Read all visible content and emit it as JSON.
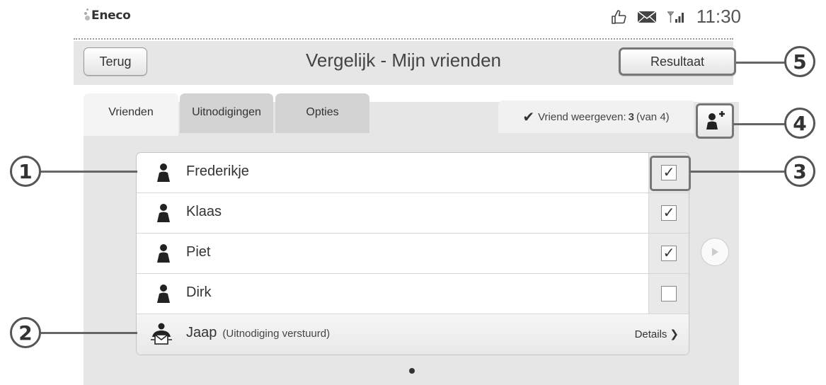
{
  "status": {
    "logo": "Eneco",
    "time": "11:30"
  },
  "header": {
    "back_label": "Terug",
    "title": "Vergelijk - Mijn vrienden",
    "result_label": "Resultaat"
  },
  "tabs": [
    {
      "label": "Vrienden",
      "active": true
    },
    {
      "label": "Uitnodigingen",
      "active": false
    },
    {
      "label": "Opties",
      "active": false
    }
  ],
  "friend_count": {
    "prefix": "Vriend weergeven:",
    "shown": "3",
    "total": "(van 4)"
  },
  "friends": [
    {
      "name": "Frederikje",
      "checked": true
    },
    {
      "name": "Klaas",
      "checked": true
    },
    {
      "name": "Piet",
      "checked": true
    },
    {
      "name": "Dirk",
      "checked": false
    }
  ],
  "invite": {
    "name": "Jaap",
    "status": "(Uitnodiging verstuurd)",
    "details_label": "Details"
  },
  "callouts": [
    "1",
    "2",
    "3",
    "4",
    "5"
  ],
  "colors": {
    "panel": "#e6e6e6",
    "callout_border": "#555555"
  }
}
